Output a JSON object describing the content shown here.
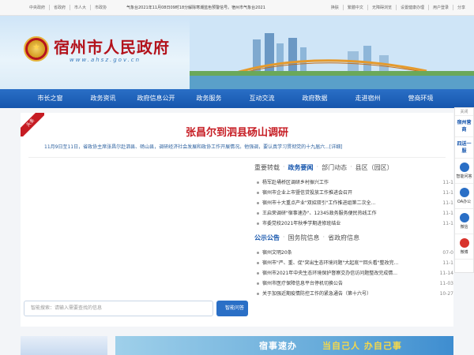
{
  "topbar": {
    "left_links": [
      "中央政府",
      "省政府",
      "市人大",
      "市政协"
    ],
    "ticker": "气象台2021年11月08日09时18分解除寒潮蓝色预警信号。宿州市气象台2021",
    "right_links": [
      "换肤",
      "繁體中文",
      "无障碍浏览",
      "设置健康办理",
      "用户登录",
      "分享"
    ]
  },
  "banner": {
    "title": "宿州市人民政府",
    "url": "www.ahsz.gov.cn"
  },
  "nav": {
    "items": [
      "市长之窗",
      "政务资讯",
      "政府信息公开",
      "政务服务",
      "互动交流",
      "政府数据",
      "走进宿州",
      "营商环境"
    ]
  },
  "headline": {
    "badge": "头条",
    "title": "张昌尔到泗县砀山调研",
    "summary": "11月9日至11日，省政协主席张昌尔赴泗县、砀山县，调研经济社会发展和政协工作开展情况。他强调，要认真学习贯彻党的十九届六...[详细]"
  },
  "search": {
    "placeholder": "智能搜索：请输入需要查找的信息",
    "smart_label": "智能问答"
  },
  "news_tabs": {
    "items": [
      "重要转载",
      "政务要闻",
      "部门动态",
      "县区（园区）"
    ],
    "active": "政务要闻",
    "list": [
      {
        "title": "杨军赴埇桥区调研乡村振兴工作",
        "date": "11-1"
      },
      {
        "title": "宿州市企业上市暨信贷投放工作推进会召开",
        "date": "11-1"
      },
      {
        "title": "宿州市十大重点产业\"双招双引\"工作推进组第二次全...",
        "date": "11-1"
      },
      {
        "title": "王启荣调研\"宿事速办\"、12345政务服务便民热线工作",
        "date": "11-1"
      },
      {
        "title": "市委党校2021年秋季学期进修班结业",
        "date": "11-1"
      }
    ]
  },
  "notice_tabs": {
    "items": [
      "公示公告",
      "国务院信息",
      "省政府信息"
    ],
    "active": "公示公告",
    "list": [
      {
        "title": "宿州文明20条",
        "date": "07-0"
      },
      {
        "title": "宿州市\"严、重、促\"突出生态环境问题\"大起底\"\"回头看\"整改完...",
        "date": "11-1"
      },
      {
        "title": "宿州市2021年中央生态环境保护督察交办信访问题整改完成情...",
        "date": "11-14"
      },
      {
        "title": "宿州市医疗保障信息平台停机切换公告",
        "date": "11-03"
      },
      {
        "title": "关于加强近期疫情防控工作的紧急通告（第十六号）",
        "date": "10-27"
      }
    ]
  },
  "float_bar": {
    "close": "关闭",
    "link1": "宿州营商",
    "link2": "四送一服",
    "icons": [
      "智能问答",
      "OA办公",
      "微信",
      "微博"
    ]
  },
  "bottom": {
    "banner_text1": "宿事速办",
    "banner_text2": "当自己人 办自己事"
  },
  "colors": {
    "nav_blue": "#1656ad",
    "headline_red": "#c61c23"
  }
}
